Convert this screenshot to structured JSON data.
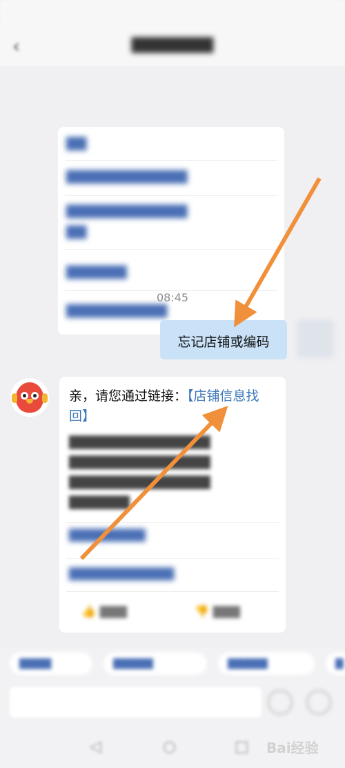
{
  "chat": {
    "timestamp": "08:45",
    "user_message": "忘记店铺或编码",
    "bot_message": {
      "text_before_link": "亲，请您通过链接：",
      "link_text": "【店铺信息找回】"
    }
  },
  "watermark": {
    "text": "Bai经验"
  },
  "colors": {
    "user_bubble": "#c9e2f8",
    "link": "#3d78b8",
    "arrow": "#f0903a"
  }
}
